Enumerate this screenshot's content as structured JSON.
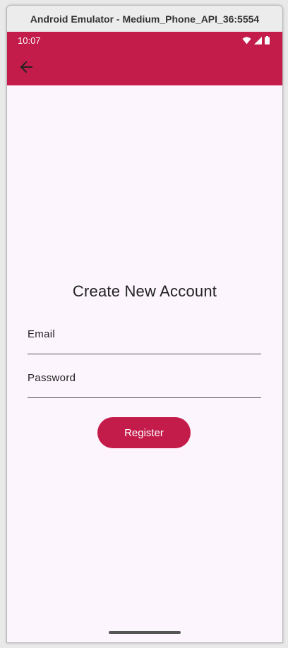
{
  "window": {
    "title": "Android Emulator - Medium_Phone_API_36:5554"
  },
  "status_bar": {
    "time": "10:07",
    "icons": [
      "wifi-icon",
      "cell-signal-icon",
      "battery-icon"
    ]
  },
  "app_bar": {
    "back_icon": "arrow-back-icon"
  },
  "form": {
    "title": "Create New Account",
    "email_label": "Email",
    "email_value": "",
    "password_label": "Password",
    "password_value": "",
    "register_label": "Register"
  },
  "colors": {
    "primary": "#c41c4a",
    "background": "#fcf5fd",
    "on_primary": "#ffffff"
  }
}
